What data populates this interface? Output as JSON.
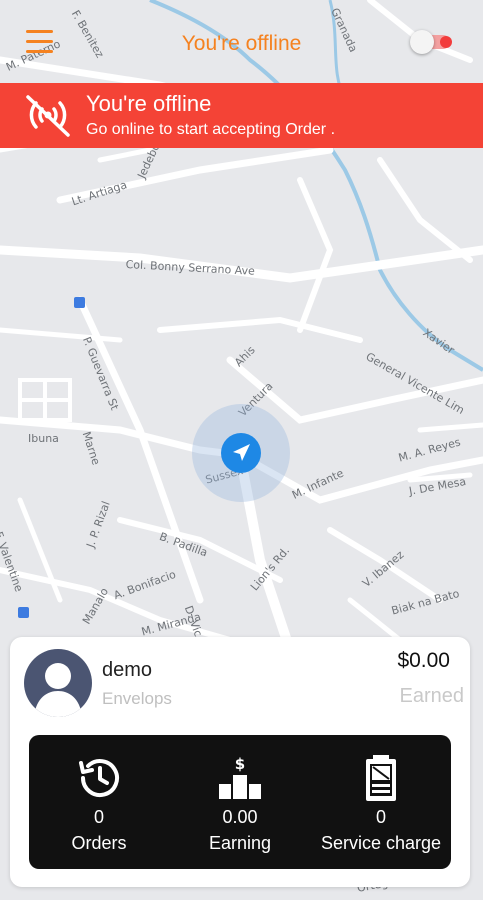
{
  "header": {
    "title": "You're offline",
    "menu_icon": "hamburger-menu-icon",
    "toggle_state": "off",
    "accent_color": "#f58220"
  },
  "banner": {
    "title": "You're offline",
    "subtitle": "Go online to start accepting Order .",
    "icon": "no-signal-icon",
    "color": "#f44336"
  },
  "map": {
    "labels": [
      "F. Benitez",
      "Granada",
      "M. Paterno",
      "Lt. Artiaga",
      "Jedebo",
      "Col. Bonny Serrano Ave",
      "P. Guevarra St",
      "Ahis",
      "General Vicente Lim",
      "Xavier",
      "Ibuna",
      "Marne",
      "Ventura",
      "Sussex",
      "M. A. Reyes",
      "J. De Mesa",
      "M. Infante",
      "F. Valentine",
      "J. P. Rizal",
      "B. Padilla",
      "A. Bonifacio",
      "Lion's Rd.",
      "V. Ibanez",
      "Biak na Bato",
      "Manalo",
      "M. Miranda",
      "D. Vic",
      "Ortega"
    ]
  },
  "card": {
    "user_name": "demo",
    "user_subtitle": "Envelops",
    "amount": "$0.00",
    "amount_label": "Earned",
    "stats": [
      {
        "icon": "history-clock-icon",
        "value": "0",
        "label": "Orders"
      },
      {
        "icon": "earning-podium-icon",
        "value": "0.00",
        "label": "Earning"
      },
      {
        "icon": "service-charge-icon",
        "value": "0",
        "label": "Service charge"
      }
    ]
  }
}
